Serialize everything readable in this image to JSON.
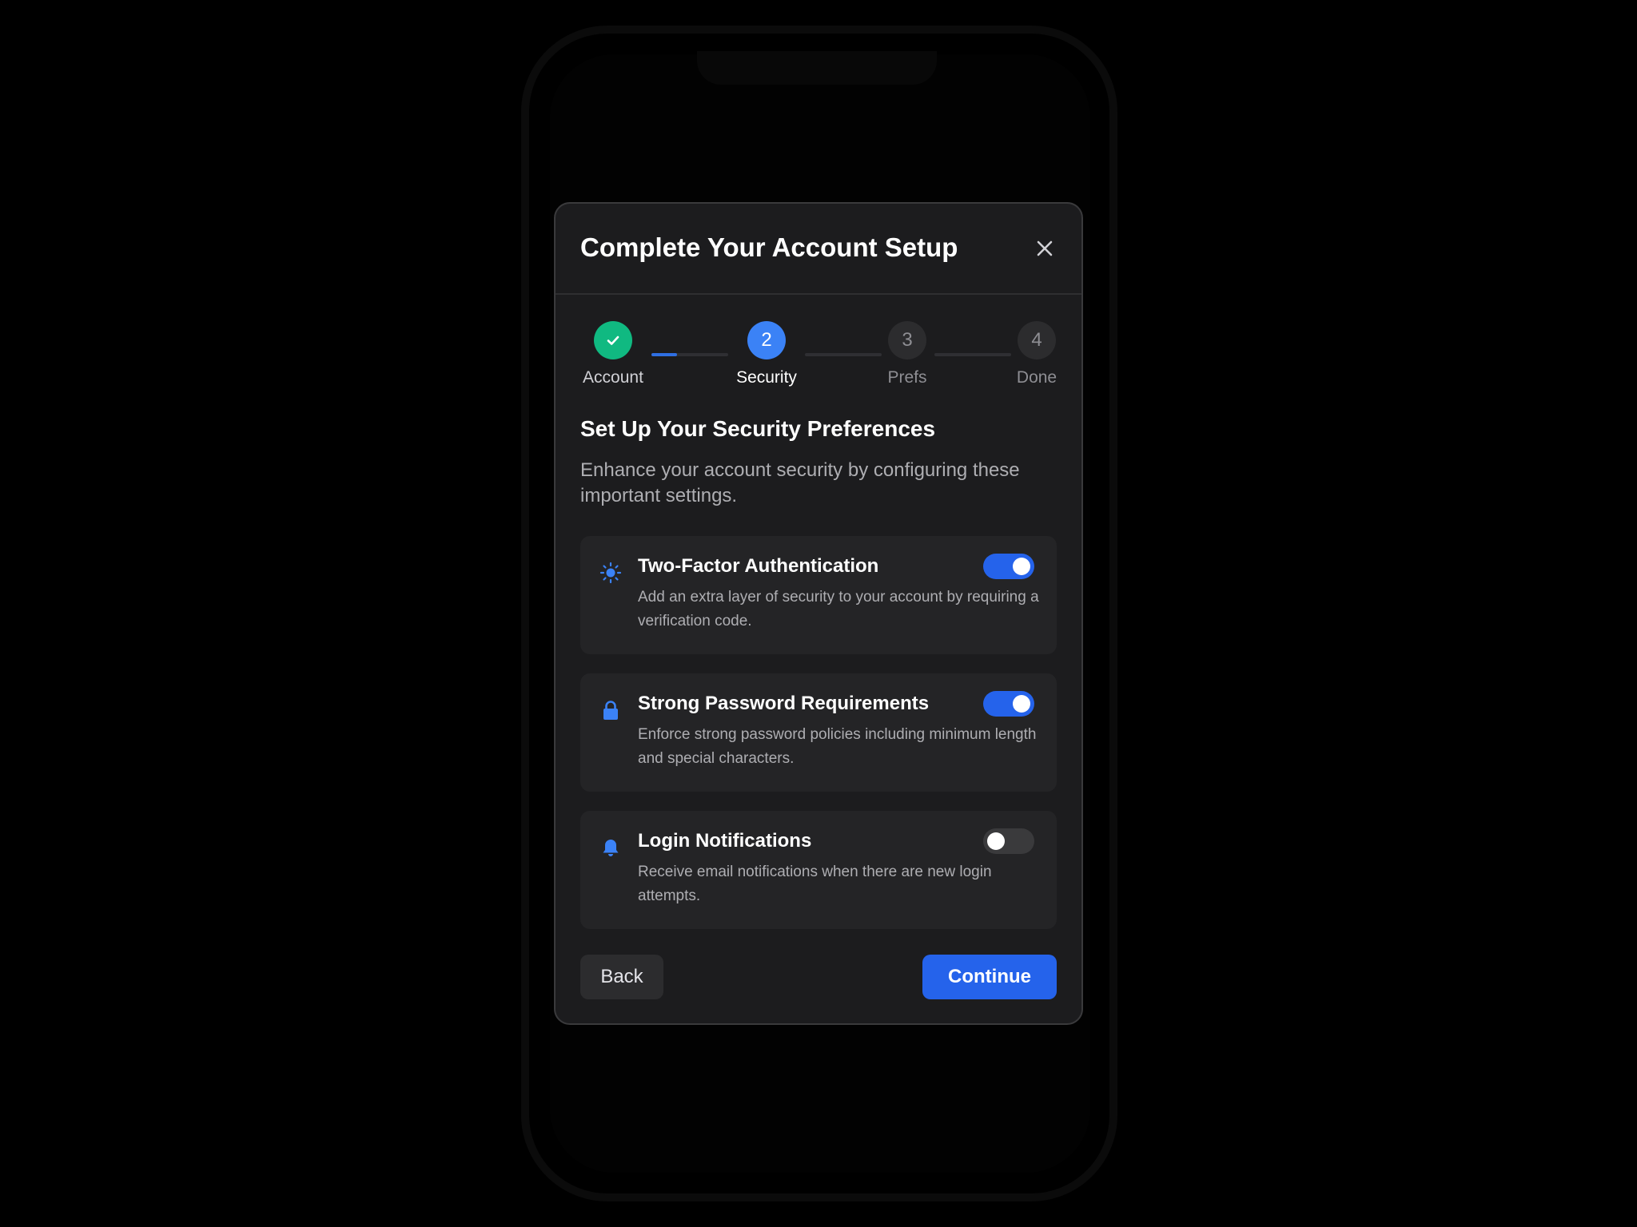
{
  "modal": {
    "title": "Complete Your Account Setup",
    "close_icon": "close-icon"
  },
  "stepper": {
    "steps": [
      {
        "number": "",
        "label": "Account",
        "state": "completed",
        "icon": "check-icon"
      },
      {
        "number": "2",
        "label": "Security",
        "state": "current"
      },
      {
        "number": "3",
        "label": "Prefs",
        "state": "upcoming"
      },
      {
        "number": "4",
        "label": "Done",
        "state": "upcoming"
      }
    ],
    "colors": {
      "completed": "#10b981",
      "current": "#3b82f6",
      "upcoming": "#2c2c2e",
      "connector_fill": "#2f6fe3"
    }
  },
  "section": {
    "title": "Set Up Your Security Preferences",
    "description": "Enhance your account security by configuring these important settings."
  },
  "settings": [
    {
      "title": "Two-Factor Authentication",
      "description": "Add an extra layer of security to your account by requiring a verification code.",
      "icon": "sun-icon",
      "enabled": true
    },
    {
      "title": "Strong Password Requirements",
      "description": "Enforce strong password policies including minimum length and special characters.",
      "icon": "lock-icon",
      "enabled": true
    },
    {
      "title": "Login Notifications",
      "description": "Receive email notifications when there are new login attempts.",
      "icon": "bell-icon",
      "enabled": false
    }
  ],
  "footer": {
    "back_label": "Back",
    "continue_label": "Continue"
  },
  "colors": {
    "accent": "#2563eb",
    "icon_blue": "#3b82f6",
    "success": "#10b981",
    "modal_bg": "#1c1c1e",
    "card_bg": "#242426"
  }
}
